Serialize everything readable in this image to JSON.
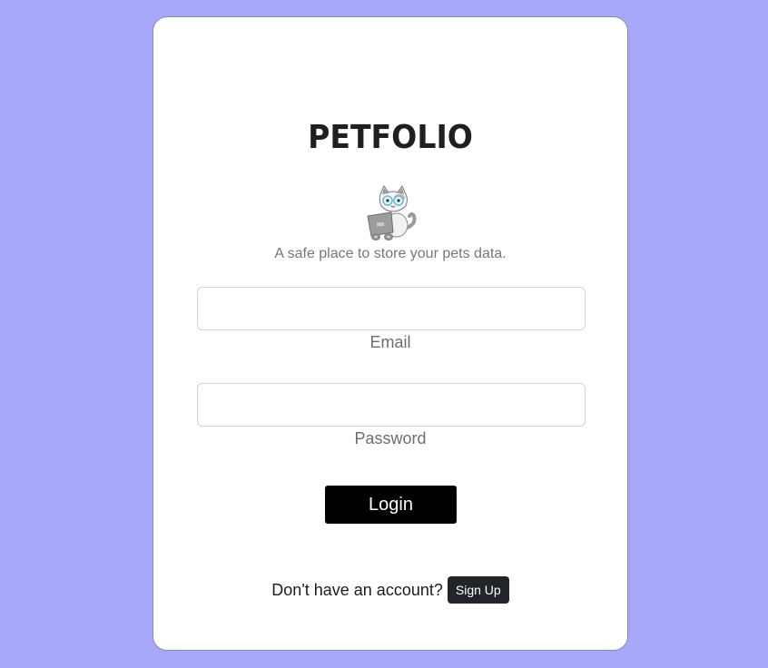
{
  "brand": {
    "title": "PETFOLIO",
    "tagline": "A safe place to store your pets data.",
    "mascot_icon": "cat-with-laptop-icon"
  },
  "form": {
    "email_value": "",
    "email_label": "Email",
    "password_value": "",
    "password_label": "Password",
    "login_label": "Login"
  },
  "signup": {
    "prompt": "Don't have an account?",
    "button_label": "Sign Up"
  },
  "colors": {
    "background": "#a8a8fb",
    "card": "#ffffff",
    "login_button": "#000000",
    "signup_button": "#212529",
    "muted_text": "#777777"
  }
}
